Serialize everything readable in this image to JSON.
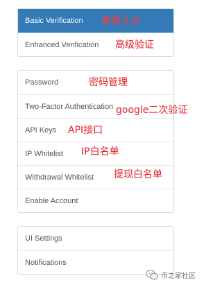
{
  "groups": [
    {
      "items": [
        {
          "label": "Basic Verification",
          "annotation": "基础认证",
          "active": true
        },
        {
          "label": "Enhanced Verification",
          "annotation": "高级验证",
          "active": false
        }
      ]
    },
    {
      "items": [
        {
          "label": "Password",
          "annotation": "密码管理"
        },
        {
          "label": "Two-Factor Authentication",
          "annotation": "google二次验证"
        },
        {
          "label": "API Keys",
          "annotation": "API接口"
        },
        {
          "label": "IP Whitelist",
          "annotation": "IP白名单"
        },
        {
          "label": "Withdrawal Whitelist",
          "annotation": "提现白名单"
        },
        {
          "label": "Enable Account",
          "annotation": ""
        }
      ]
    },
    {
      "items": [
        {
          "label": "UI Settings",
          "annotation": ""
        },
        {
          "label": "Notifications",
          "annotation": ""
        }
      ]
    }
  ],
  "watermark": {
    "icon": "wechat-icon",
    "text": "币之家社区"
  },
  "colors": {
    "active_bg": "#337ab7",
    "annotation": "#e4202a"
  }
}
